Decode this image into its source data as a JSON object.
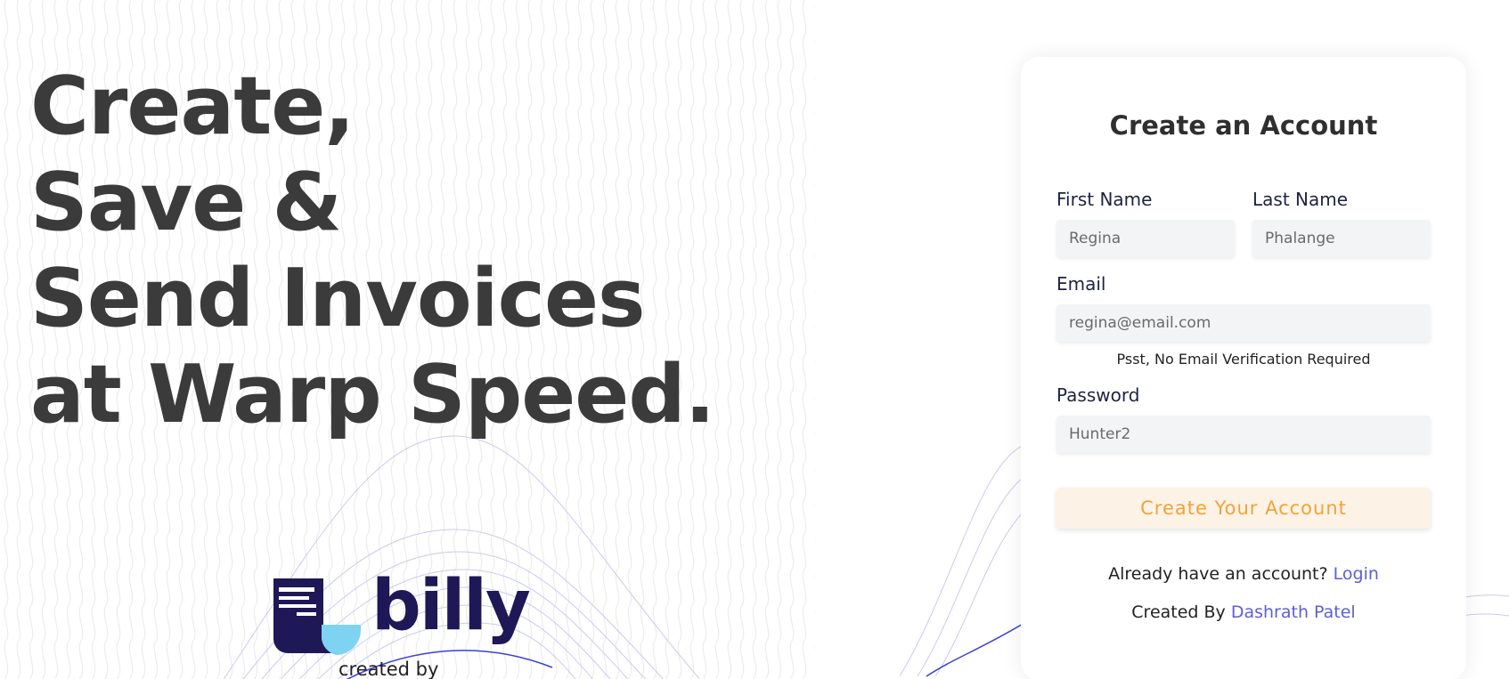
{
  "hero": {
    "line1": "Create,",
    "line2": "Save &",
    "line3": "Send Invoices",
    "line4": "at Warp Speed."
  },
  "brand": {
    "name": "billy",
    "created_by": "created by",
    "icon": "receipt-logo-icon",
    "colors": {
      "dark": "#1e1856",
      "light": "#7fd3f2"
    }
  },
  "form": {
    "title": "Create an Account",
    "first_name": {
      "label": "First Name",
      "placeholder": "Regina"
    },
    "last_name": {
      "label": "Last Name",
      "placeholder": "Phalange"
    },
    "email": {
      "label": "Email",
      "placeholder": "regina@email.com"
    },
    "email_hint": "Psst, No Email Verification Required",
    "password": {
      "label": "Password",
      "placeholder": "Hunter2"
    },
    "submit_label": "Create Your Account",
    "login_prompt": "Already have an account?",
    "login_link": "Login",
    "credit_prefix": "Created By",
    "credit_name": "Dashrath Patel"
  },
  "colors": {
    "accent": "#f2a23a",
    "button_bg": "#fdf2e6",
    "link": "#5b5fd6",
    "text_dark": "#3b3b3b"
  }
}
